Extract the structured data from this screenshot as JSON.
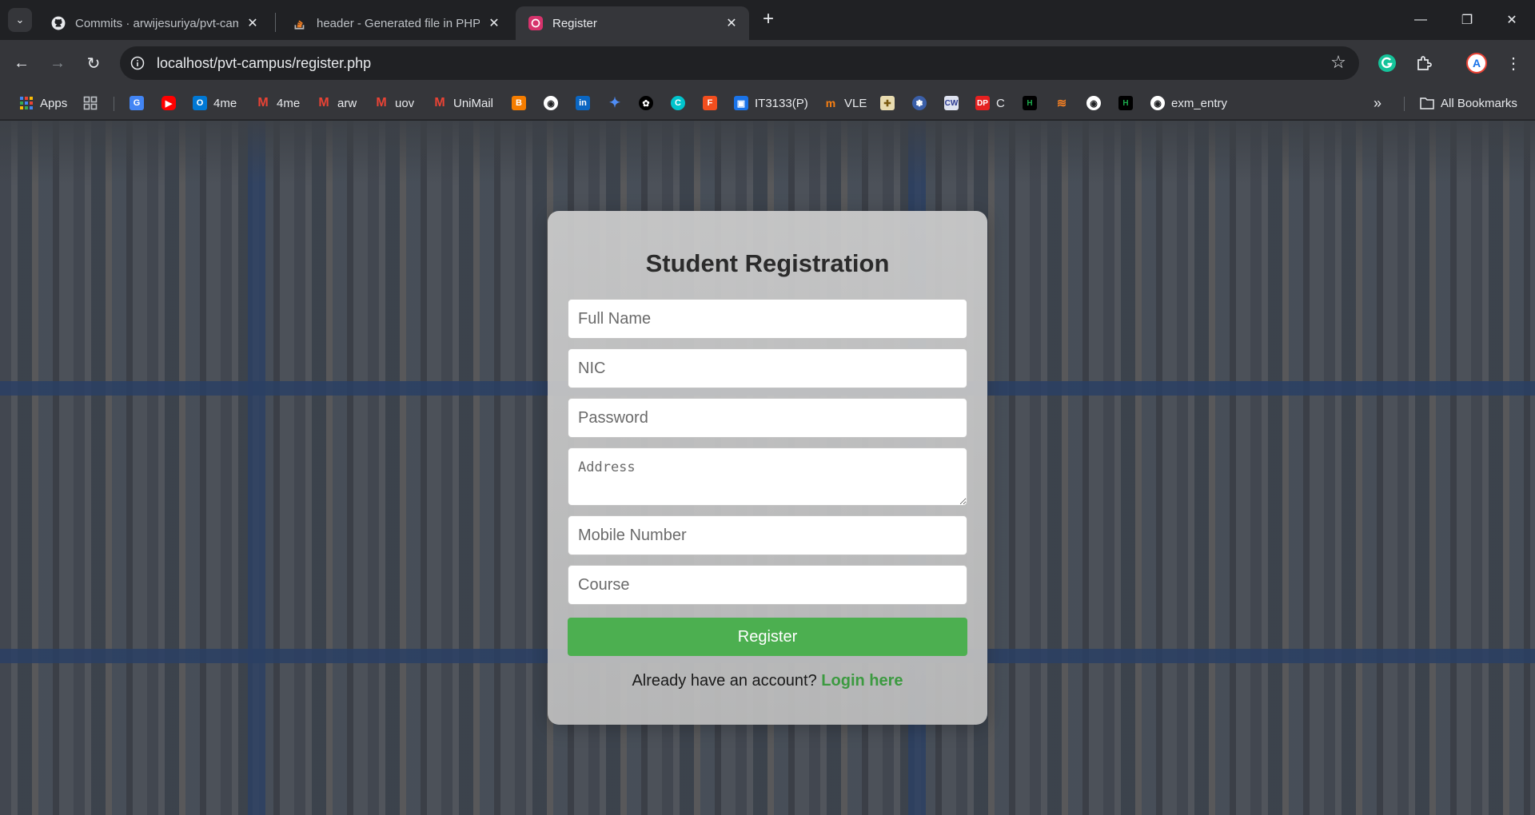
{
  "browser": {
    "tabs": [
      {
        "title": "Commits · arwijesuriya/pvt-campus",
        "icon": "github-icon",
        "active": false
      },
      {
        "title": "header - Generated file in PHP",
        "icon": "stackoverflow-icon",
        "active": false
      },
      {
        "title": "Register",
        "icon": "site-favicon-icon",
        "active": true
      }
    ],
    "url": "localhost/pvt-campus/register.php",
    "bookmarks": [
      {
        "label": "Apps",
        "icon": "apps-grid-icon",
        "color": "#4285f4"
      },
      {
        "label": "",
        "icon": "tab-groups-icon",
        "color": "#bdc1c6"
      },
      {
        "label": "",
        "icon": "google-translate-icon",
        "color": "#4285f4"
      },
      {
        "label": "",
        "icon": "youtube-icon",
        "color": "#ff0000"
      },
      {
        "label": "4me",
        "icon": "outlook-icon",
        "color": "#0078d4"
      },
      {
        "label": "4me",
        "icon": "gmail-icon",
        "color": "#ea4335"
      },
      {
        "label": "arw",
        "icon": "gmail-icon",
        "color": "#ea4335"
      },
      {
        "label": "uov",
        "icon": "gmail-icon",
        "color": "#ea4335"
      },
      {
        "label": "UniMail",
        "icon": "gmail-icon",
        "color": "#ea4335"
      },
      {
        "label": "",
        "icon": "blogger-icon",
        "color": "#f57d00"
      },
      {
        "label": "",
        "icon": "github-icon",
        "color": "#ffffff"
      },
      {
        "label": "",
        "icon": "linkedin-icon",
        "color": "#0a66c2"
      },
      {
        "label": "",
        "icon": "gemini-icon",
        "color": "#4f8df5"
      },
      {
        "label": "",
        "icon": "chatgpt-icon",
        "color": "#ffffff"
      },
      {
        "label": "",
        "icon": "canva-icon",
        "color": "#00c4cc"
      },
      {
        "label": "",
        "icon": "figma-icon",
        "color": "#f24e1e"
      },
      {
        "label": "IT3133(P)",
        "icon": "classroom-icon",
        "color": "#1a73e8"
      },
      {
        "label": "VLE",
        "icon": "moodle-icon",
        "color": "#f98012"
      },
      {
        "label": "",
        "icon": "university-crest-icon",
        "color": "#d4b15a"
      },
      {
        "label": "",
        "icon": "university-logo-icon",
        "color": "#3b5fa8"
      },
      {
        "label": "",
        "icon": "cw-icon",
        "color": "#2b3990"
      },
      {
        "label": "C",
        "icon": "dp-icon",
        "color": "#e52020"
      },
      {
        "label": "",
        "icon": "hackerrank-icon",
        "color": "#1ba94c"
      },
      {
        "label": "",
        "icon": "stackoverflow-icon",
        "color": "#f48024"
      },
      {
        "label": "",
        "icon": "github-icon",
        "color": "#ffffff"
      },
      {
        "label": "",
        "icon": "hackerrank-icon",
        "color": "#1ba94c"
      },
      {
        "label": "exm_entry",
        "icon": "github-icon",
        "color": "#ffffff"
      }
    ],
    "all_bookmarks": "All Bookmarks"
  },
  "form": {
    "title": "Student Registration",
    "fields": {
      "full_name": "Full Name",
      "nic": "NIC",
      "password": "Password",
      "address": "Address",
      "mobile": "Mobile Number",
      "course": "Course"
    },
    "submit_label": "Register",
    "login_prompt": "Already have an account?",
    "login_link": "Login here"
  },
  "colors": {
    "accent_green": "#4caf50",
    "link_green": "#3c9a40"
  }
}
